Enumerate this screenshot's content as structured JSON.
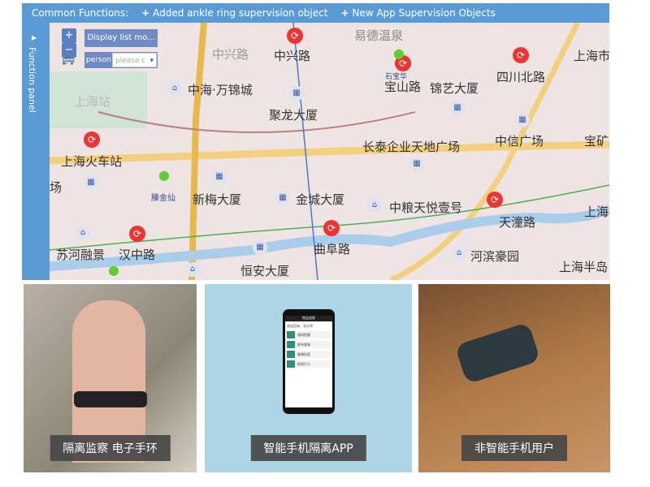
{
  "topbar": {
    "title": "Common Functions:",
    "actions": [
      "Added ankle ring supervision object",
      "New App Supervision Objects"
    ],
    "plus_icon": "+"
  },
  "side_panel": {
    "label": "Function panel"
  },
  "map": {
    "zoom_in": "+",
    "zoom_out": "−",
    "display_list": "Display list mo...",
    "person_label": "person",
    "person_select": "please c",
    "labels": [
      "中兴路",
      "中兴路",
      "易德温泉",
      "宝山路",
      "锦艺大厦",
      "四川北路",
      "上海市一人民医",
      "中海·万锦城",
      "聚龙大厦",
      "上海站",
      "长泰企业天地广场",
      "中信广场",
      "宝矿",
      "上海火车站",
      "新梅大厦",
      "金城大厦",
      "中粮天悦壹号",
      "天潼路",
      "上海",
      "苏河融景",
      "汉中路",
      "曲阜路",
      "河滨豪园",
      "恒安大厦",
      "上海半岛",
      "滕金仙",
      "石宝华",
      "场"
    ],
    "colors": {
      "metro": "#e53935",
      "road": "#e8b84a",
      "river": "#a9cdea"
    }
  },
  "cards": [
    {
      "caption": "隔离监察 电子手环"
    },
    {
      "caption": "智能手机隔离APP",
      "phone": {
        "title": "悦足居家",
        "greeting": "欢迎回来，张天师",
        "items": [
          "通知提醒",
          "联系客服",
          "健康档案",
          "报到打卡"
        ]
      }
    },
    {
      "caption": "非智能手机用户"
    }
  ]
}
